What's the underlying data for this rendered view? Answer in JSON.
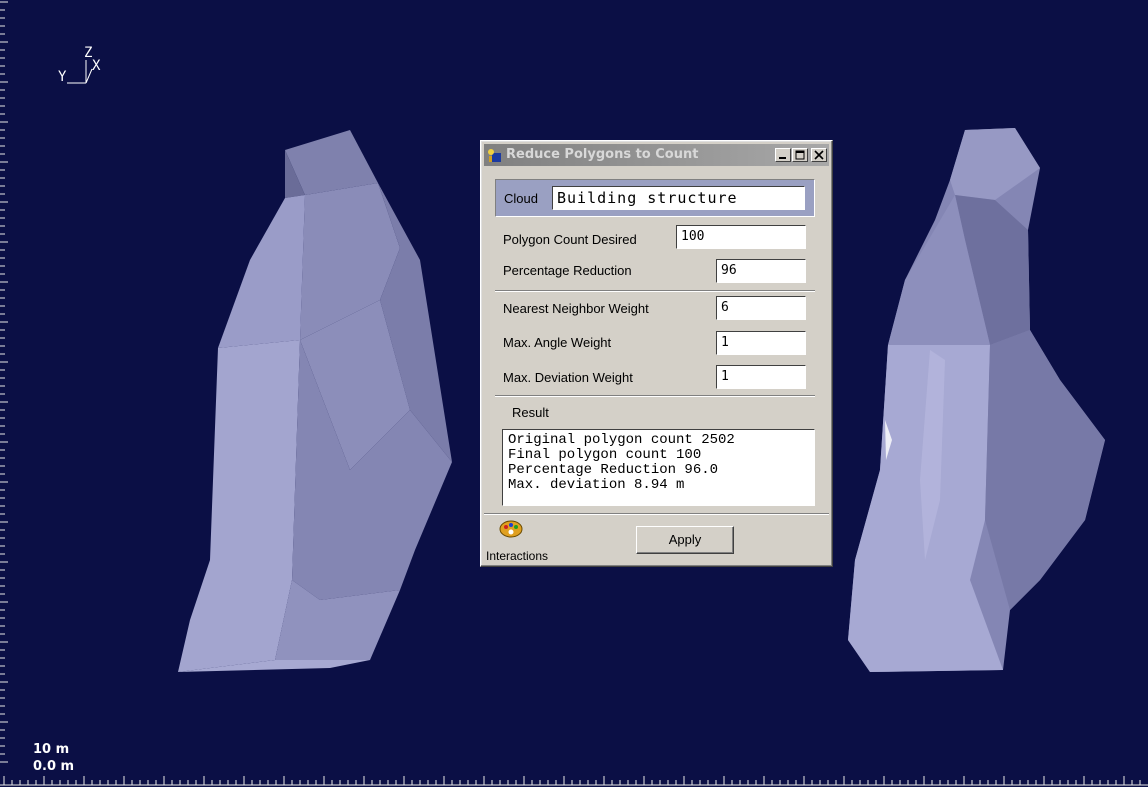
{
  "viewport": {
    "axis_labels": {
      "z": "Z",
      "y": "Y",
      "x": "X"
    },
    "scale_labels": {
      "top": "10 m",
      "bottom": "0.0 m"
    },
    "colors": {
      "background": "#0b0f45",
      "mesh": "#8f91bd",
      "ruler": "#e8e8e8"
    }
  },
  "dialog": {
    "title": "Reduce Polygons to Count",
    "title_icon": "app-icon",
    "window_buttons": [
      "minimize-icon",
      "maximize-icon",
      "close-icon"
    ],
    "cloud": {
      "label": "Cloud",
      "value": "Building structure"
    },
    "fields": {
      "polygon_count": {
        "label": "Polygon Count Desired",
        "value": "100"
      },
      "percentage_reduction": {
        "label": "Percentage Reduction",
        "value": "96"
      },
      "nearest_neighbor": {
        "label": "Nearest Neighbor Weight",
        "value": "6"
      },
      "max_angle": {
        "label": "Max. Angle Weight",
        "value": "1"
      },
      "max_deviation": {
        "label": "Max. Deviation Weight",
        "value": "1"
      }
    },
    "result": {
      "label": "Result",
      "lines": [
        "Original polygon count 2502",
        "Final polygon count 100",
        "Percentage Reduction 96.0",
        "Max. deviation 8.94 m"
      ]
    },
    "interactions_label": "Interactions",
    "apply_label": "Apply"
  }
}
